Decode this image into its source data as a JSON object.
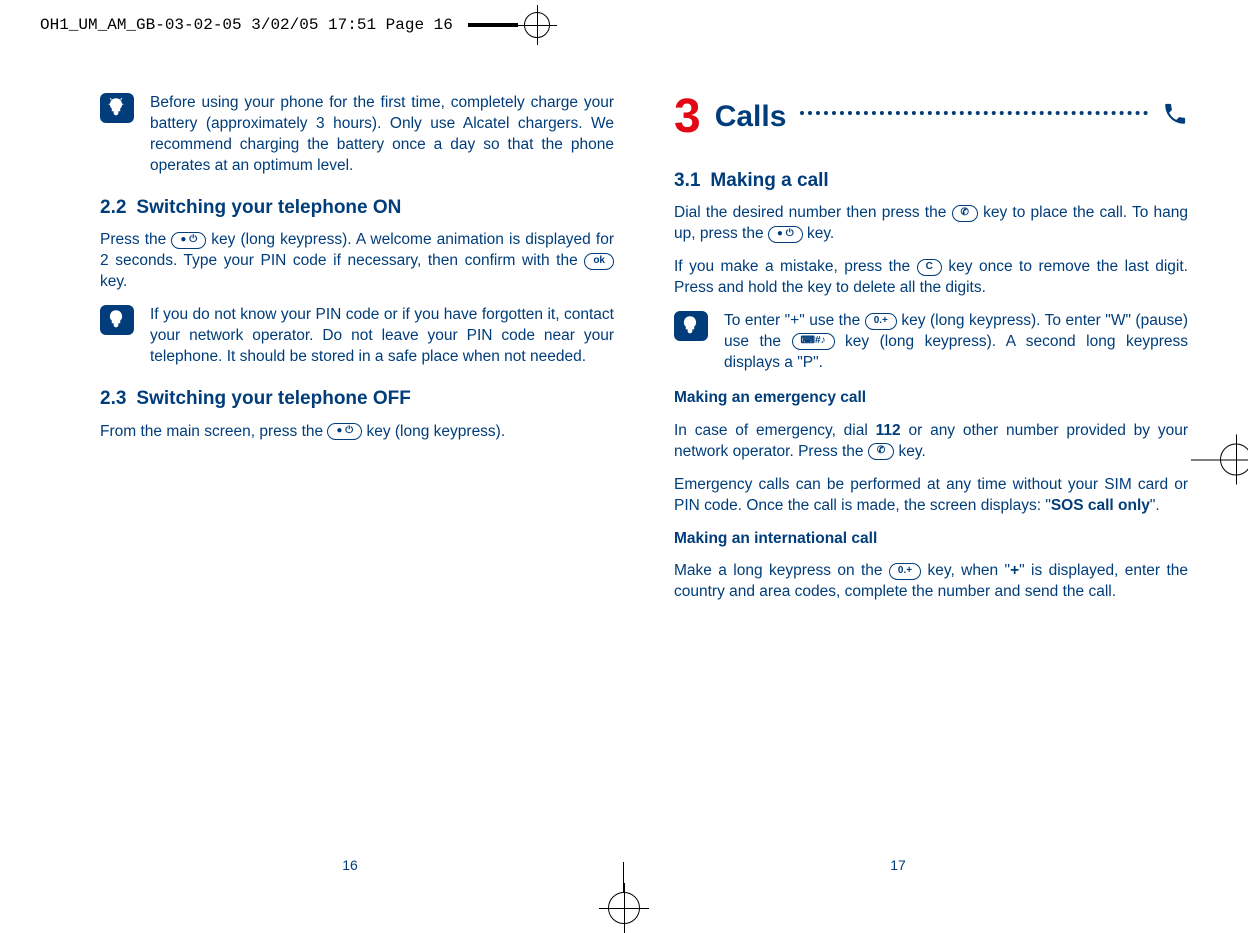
{
  "header": {
    "crop": "OH1_UM_AM_GB-03-02-05   3/02/05  17:51  Page 16"
  },
  "left": {
    "tip1": "Before using your phone for the first time, completely charge your battery (approximately 3 hours). Only use Alcatel chargers. We recommend charging the battery once a day so that the phone operates at an optimum level.",
    "s22_num": "2.2",
    "s22_title": "Switching your telephone ON",
    "p22a_1": "Press the ",
    "p22a_key1": "● ⏻",
    "p22a_2": " key (long keypress). A welcome animation is displayed for 2 seconds. Type your PIN code if necessary, then confirm with the ",
    "p22a_key2": "ok",
    "p22a_3": " key.",
    "tip2": "If you do not know your PIN code or if you have forgotten it, contact your network operator. Do not leave your PIN code near your telephone. It should be stored in a safe place when not needed.",
    "s23_num": "2.3",
    "s23_title": "Switching your telephone OFF",
    "p23_1": "From the main screen, press the ",
    "p23_key": "● ⏻",
    "p23_2": " key (long keypress).",
    "pageno": "16"
  },
  "right": {
    "chnum": "3",
    "chtitle": "Calls",
    "s31_num": "3.1",
    "s31_title": "Making a call",
    "p1_1": "Dial the desired number then press the ",
    "p1_k1": "✆",
    "p1_2": " key to place the call. To hang up, press the ",
    "p1_k2": "● ⏻",
    "p1_3": " key.",
    "p2_1": "If you make a mistake, press the ",
    "p2_k": "C",
    "p2_2": " key once to remove the last digit. Press and hold the key to delete all the digits.",
    "tip_a": "To enter \"+\" use the ",
    "tip_k1": "0.+",
    "tip_b": " key (long keypress). To enter \"W\" (pause) use the ",
    "tip_k2": "⌨#♪",
    "tip_c": " key (long keypress). A second long keypress displays a \"P\".",
    "h_em": "Making an emergency call",
    "p3_1": "In case of emergency, dial ",
    "p3_b": "112",
    "p3_2": " or any other number provided by your network operator. Press the ",
    "p3_k": "✆",
    "p3_3": " key.",
    "p4_1": "Emergency calls can be performed at any time without your SIM card or PIN code. Once the call is made, the screen displays: \"",
    "p4_b": "SOS call only",
    "p4_2": "\".",
    "h_intl": "Making an international call",
    "p5_1": "Make a long keypress on the ",
    "p5_k": "0.+",
    "p5_2": " key, when \"",
    "p5_b": "+",
    "p5_3": "\" is displayed, enter the country and area codes, complete the number and send the call.",
    "pageno": "17"
  }
}
